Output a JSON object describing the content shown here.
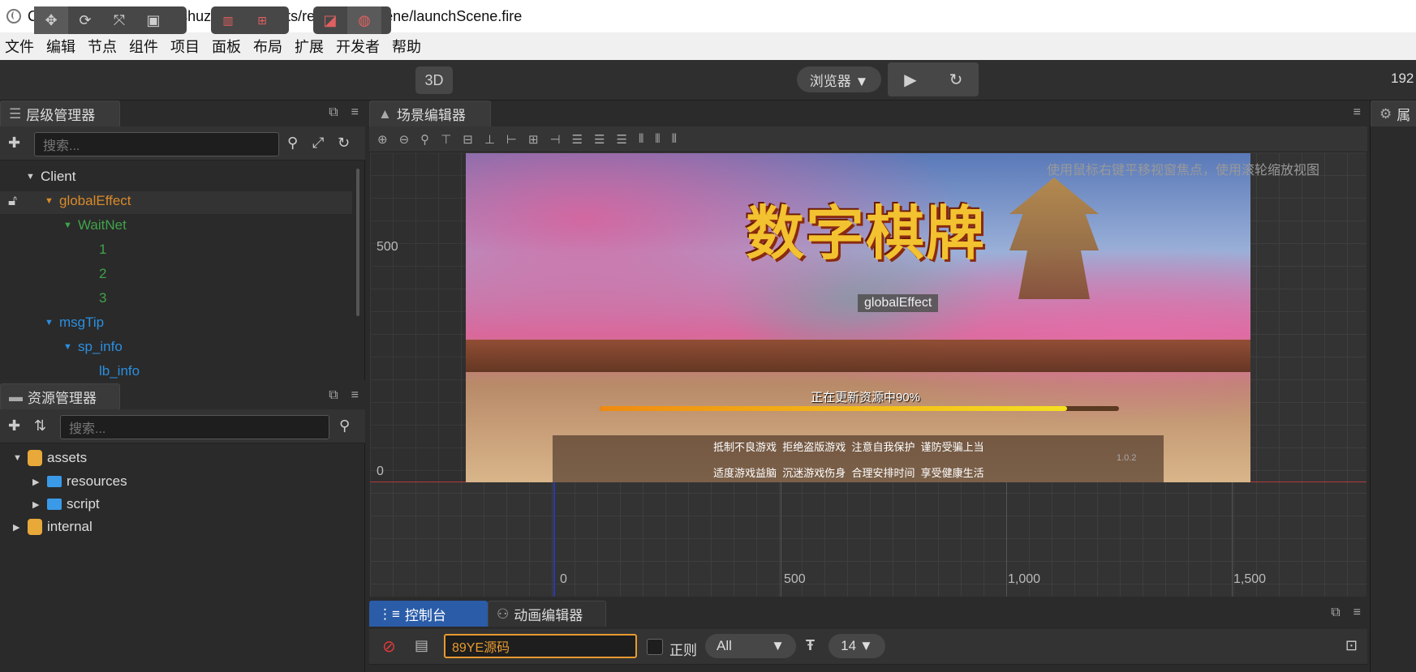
{
  "window": {
    "title": "Cocos Creator - Client_shuzi - db://assets/resources/scene/launchScene.fire"
  },
  "menu": [
    "文件",
    "编辑",
    "节点",
    "组件",
    "项目",
    "面板",
    "布局",
    "扩展",
    "开发者",
    "帮助"
  ],
  "toolbar": {
    "btn_3d": "3D",
    "preview_select": "浏览器 ▼",
    "resolution": "192"
  },
  "hierarchy": {
    "tab_label": "层级管理器",
    "search_placeholder": "搜索...",
    "nodes": [
      {
        "label": "Client",
        "color": "#dddddd"
      },
      {
        "label": "globalEffect",
        "color": "#d98a2a"
      },
      {
        "label": "WaitNet",
        "color": "#3fa34a"
      },
      {
        "label": "1",
        "color": "#3fa34a"
      },
      {
        "label": "2",
        "color": "#3fa34a"
      },
      {
        "label": "3",
        "color": "#3fa34a"
      },
      {
        "label": "msgTip",
        "color": "#2b8fe0"
      },
      {
        "label": "sp_info",
        "color": "#2b8fe0"
      },
      {
        "label": "lb_info",
        "color": "#2b8fe0"
      }
    ]
  },
  "assets": {
    "tab_label": "资源管理器",
    "search_placeholder": "搜索...",
    "items": [
      "assets",
      "resources",
      "script",
      "internal"
    ]
  },
  "scene": {
    "tab_label": "场景编辑器",
    "hint": "使用鼠标右键平移视窗焦点，使用滚轮缩放视图",
    "ruler_y": [
      "500",
      "0"
    ],
    "ruler_x": [
      "0",
      "500",
      "1,000",
      "1,500"
    ],
    "game": {
      "logo_text": "数字棋牌",
      "node_label": "globalEffect",
      "loading_text": "正在更新资源中90%",
      "progress": 0.9,
      "notice_line1": "抵制不良游戏  拒绝盗版游戏  注意自我保护  谨防受骗上当",
      "notice_line2": "适度游戏益脑  沉迷游戏伤身  合理安排时间  享受健康生活",
      "version": "1.0.2"
    }
  },
  "right_panel": {
    "tab_label": "属"
  },
  "console": {
    "tab_console": "控制台",
    "tab_anim": "动画编辑器",
    "filter_value": "89YE源码",
    "regex_label": "正则",
    "level_select": "All",
    "font_size": "14"
  }
}
